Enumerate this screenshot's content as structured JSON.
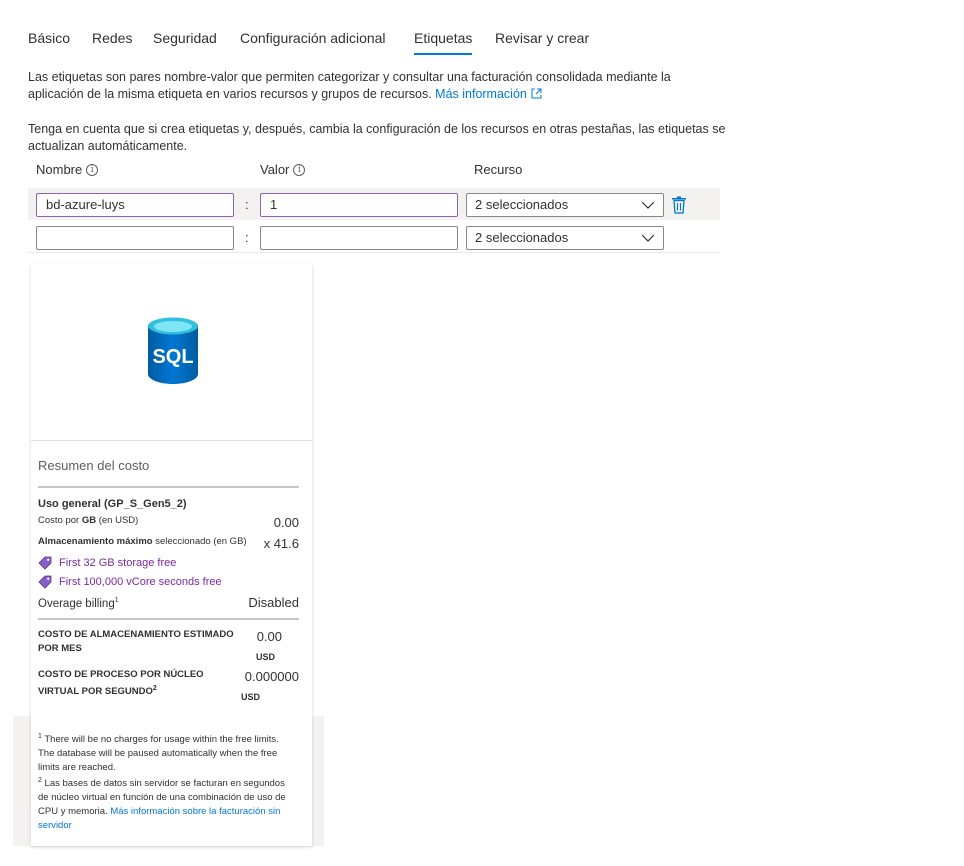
{
  "tabs": [
    {
      "label": "Básico",
      "active": false
    },
    {
      "label": "Redes",
      "active": false
    },
    {
      "label": "Seguridad",
      "active": false
    },
    {
      "label": "Configuración adicional",
      "active": false
    },
    {
      "label": "Etiquetas",
      "active": true
    },
    {
      "label": "Revisar y crear",
      "active": false
    }
  ],
  "intro": {
    "text": "Las etiquetas son pares nombre-valor que permiten categorizar y consultar una facturación consolidada mediante la aplicación de la misma etiqueta en varios recursos y grupos de recursos.",
    "link": "Más información",
    "note": "Tenga en cuenta que si crea etiquetas y, después, cambia la configuración de los recursos en otras pestañas, las etiquetas se actualizan automáticamente."
  },
  "table": {
    "headers": {
      "name": "Nombre",
      "value": "Valor",
      "resource": "Recurso"
    },
    "separator": ":",
    "rows": [
      {
        "name": "bd-azure-luys",
        "value": "1",
        "resource": "2 seleccionados"
      },
      {
        "name": "",
        "value": "",
        "resource": "2 seleccionados"
      }
    ]
  },
  "cost_summary": {
    "title": "Resumen del costo",
    "tier": "Uso general (GP_S_Gen5_2)",
    "cost_per_gb_label": "Costo por",
    "cost_per_gb_unit": "GB",
    "cost_per_gb_currency": "(en USD)",
    "cost_per_gb_value": "0.00",
    "max_storage_label_bold": "Almacenamiento máximo",
    "max_storage_label_rest": "seleccionado (en GB)",
    "max_storage_value": "x 41.6",
    "promos": [
      "First 32 GB storage free",
      "First 100,000 vCore seconds free"
    ],
    "overage_label": "Overage billing",
    "overage_sup": "1",
    "overage_value": "Disabled",
    "storage_cost_label": "COSTO DE ALMACENAMIENTO ESTIMADO POR MES",
    "storage_cost_value": "0.00",
    "storage_cost_currency": "USD",
    "compute_cost_label": "COSTO DE PROCESO POR NÚCLEO VIRTUAL POR SEGUNDO",
    "compute_cost_sup": "2",
    "compute_cost_value": "0.000000",
    "compute_cost_currency": "USD",
    "sql_label": "SQL"
  },
  "footnotes": {
    "n1_num": "1",
    "n1": "There will be no charges for usage within the free limits. The database will be paused automatically when the free limits are reached.",
    "n2_num": "2",
    "n2": "Las bases de datos sin servidor se facturan en segundos de núcleo virtual en función de una combinación de uso de CPU y memoria.",
    "n2_link": "Más información sobre la facturación sin servidor"
  },
  "colors": {
    "accent": "#0078d4",
    "promo": "#7a2aa0",
    "focus_border": "#8764b8"
  }
}
